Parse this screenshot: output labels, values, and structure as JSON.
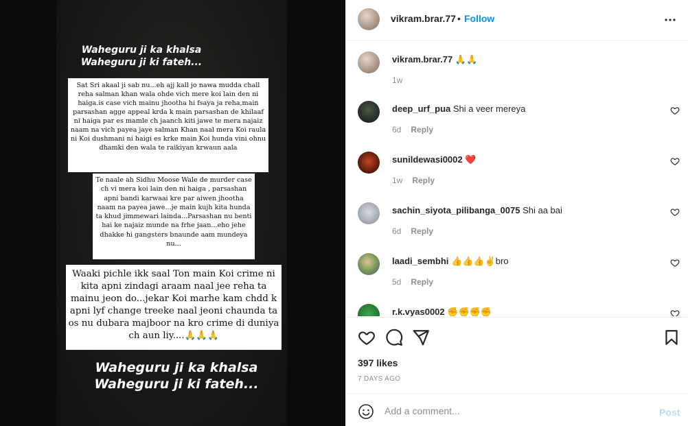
{
  "post": {
    "story_header": "Waheguru ji ka khalsa\nWaheguru ji ki fateh...",
    "note1": "Sat Sri akaal ji sab nu...eh ajj kall jo nawa mudda chall reha salman khan wala ohde vich mere koi lain den ni haiga.is case vich mainu jhootha hi fsaya ja reha,main parsashan agge appeal krda k main parsashan de khilaaf ni haiga par es mamle ch jaanch kiti jawe te mera najaiz naam na vich payea jaye salman Khan naal mera Koi raula ni Koi dushmani ni haigi es krke main Koi hunda vini ohnu dhamki den wala te raikiyan krwaun aala",
    "note2": "Te naale ah Sidhu Moose Wale de murder case ch vi mera koi lain den ni haiga , parsashan apni bandi karwaai kre par aiwen jhootha naam na payea jawe...je main kujh kita hunda ta khud jimmewari lainda...Parsashan nu benti hai ke najaiz munde na frhe jaan...eho jehe dhakke hi gangsters bnaunde aam mundeya nu...",
    "note3": "Waaki pichle ikk saal Ton main Koi crime ni kita apni zindagi araam naal jee reha ta mainu jeon do...jekar Koi marhe kam chdd k apni lyf change treeke naal jeoni chaunda ta os nu dubara majboor na kro crime di duniya ch aun liy....🙏🙏🙏",
    "story_footer": "Waheguru ji ka khalsa\nWaheguru ji ki fateh..."
  },
  "header": {
    "username": "vikram.brar.77",
    "separator": "•",
    "follow_label": "Follow",
    "more_icon": "more-horizontal-icon"
  },
  "caption": {
    "username": "vikram.brar.77",
    "text": "🙏🙏",
    "time": "1w"
  },
  "comments": [
    {
      "username": "deep_urf_pua",
      "text": "Shi a veer mereya",
      "time": "6d",
      "reply": "Reply"
    },
    {
      "username": "sunildewasi0002",
      "text": "❤️",
      "time": "1w",
      "reply": "Reply"
    },
    {
      "username": "sachin_siyota_pilibanga_0075",
      "text": "Shi aa bai",
      "time": "6d",
      "reply": "Reply"
    },
    {
      "username": "laadi_sembhi",
      "text": "👍👍👍✌️bro",
      "time": "5d",
      "reply": "Reply"
    },
    {
      "username": "r.k.vyas0002",
      "text": "✊✊✊✊",
      "time": "",
      "reply": ""
    }
  ],
  "actions": {
    "likes": "397 likes",
    "date": "7 DAYS AGO"
  },
  "add_comment": {
    "placeholder": "Add a comment...",
    "post_label": "Post"
  },
  "colors": {
    "accent": "#0095f6",
    "post_disabled": "#b2dffc",
    "muted": "#8e8e8e",
    "text": "#262626"
  }
}
